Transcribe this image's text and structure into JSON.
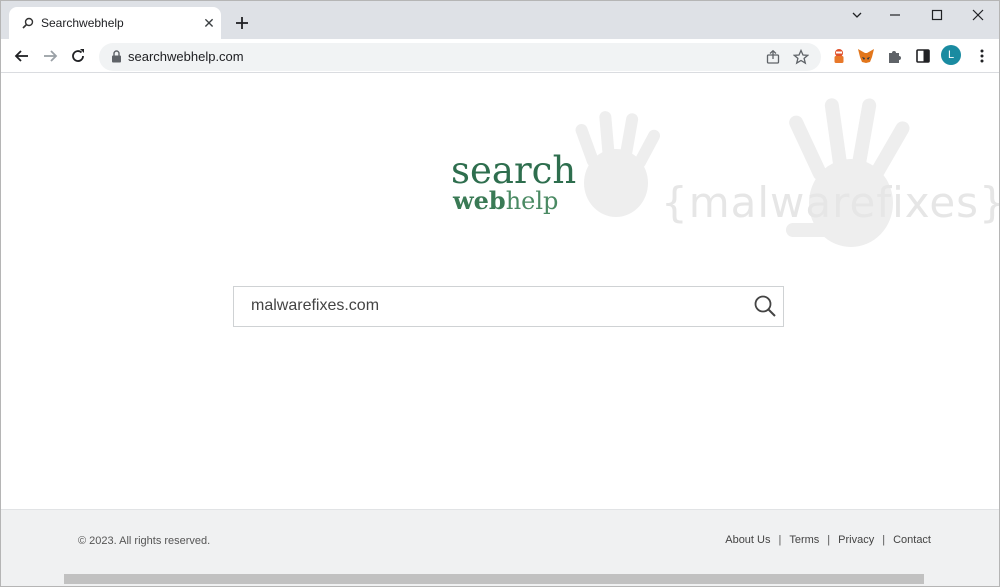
{
  "browser": {
    "tab_title": "Searchwebhelp",
    "address": "searchwebhelp.com",
    "profile_initial": "L"
  },
  "page": {
    "logo_line1": "search",
    "logo_bold": "web",
    "logo_rest": "help",
    "search_value": "malwarefixes.com",
    "watermark_text": "{malwarefixes}"
  },
  "footer": {
    "copyright": "© 2023. All rights reserved.",
    "links": [
      "About Us",
      "Terms",
      "Privacy",
      "Contact"
    ]
  },
  "colors": {
    "brand_green": "#2e6e4e",
    "avatar": "#1a8ba1"
  }
}
